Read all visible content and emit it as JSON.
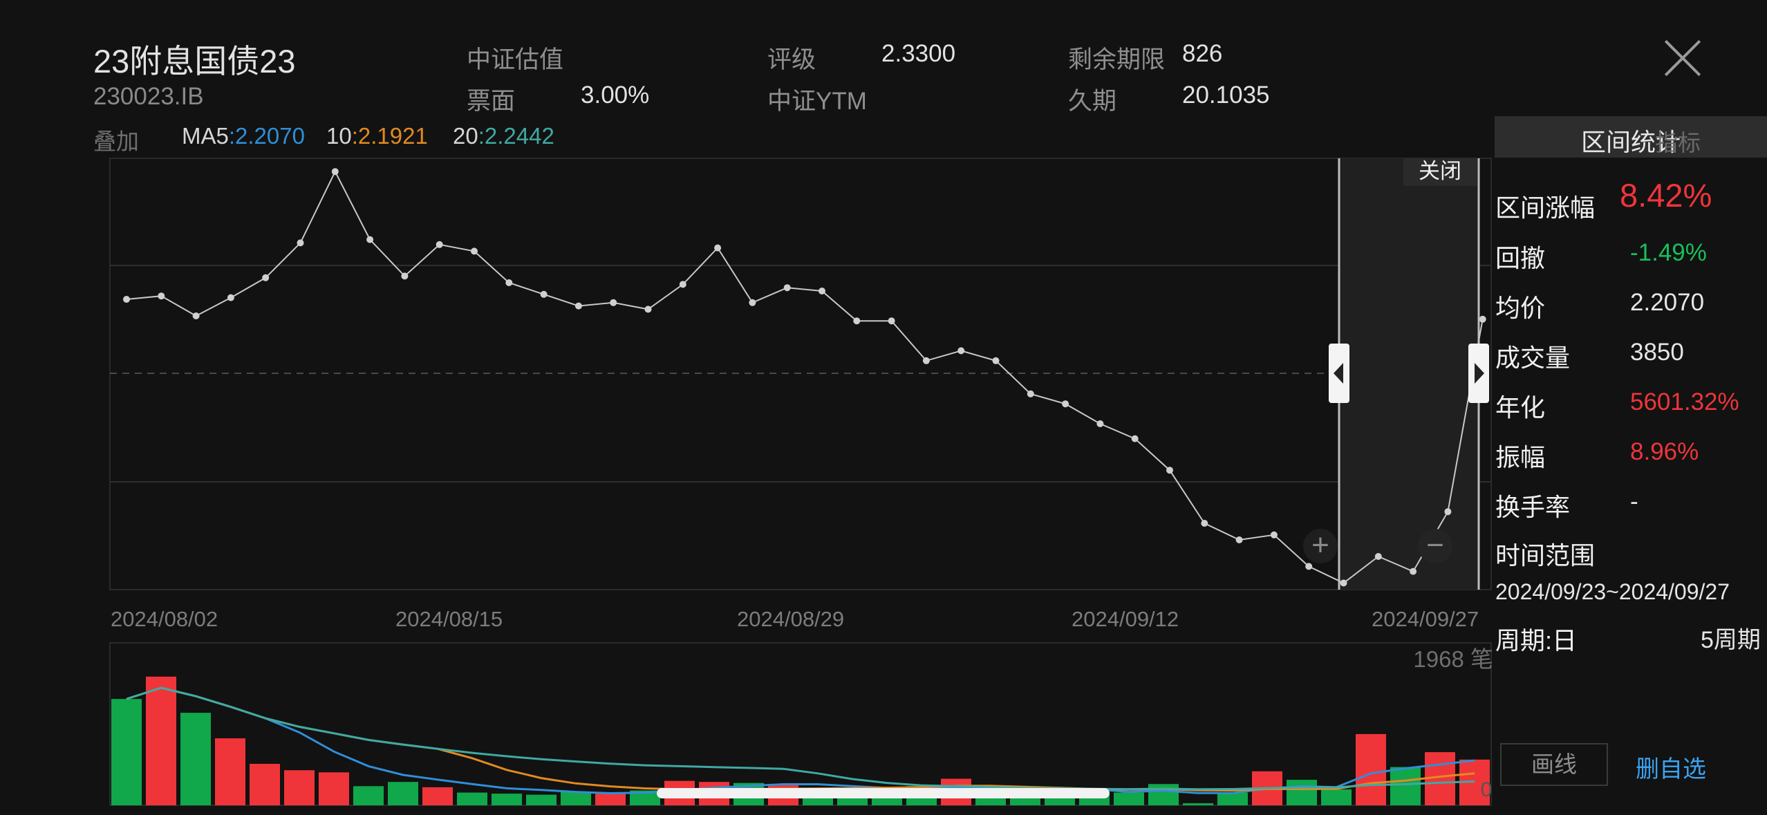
{
  "header": {
    "title": "23附息国债23",
    "code": "230023.IB",
    "valuation_label": "中证估值",
    "rating_label": "评级",
    "rating_value": "2.3300",
    "remaining_label": "剩余期限",
    "remaining_value": "826",
    "coupon_label": "票面",
    "coupon_value": "3.00%",
    "ytm_label": "中证YTM",
    "duration_label": "久期",
    "duration_value": "20.1035"
  },
  "overlay": {
    "label": "叠加",
    "ma5_label": "MA5",
    "ma5_value": ":2.2070",
    "ma10_label": "10",
    "ma10_value": ":2.1921",
    "ma20_label": "20",
    "ma20_value": ":2.2442"
  },
  "chart": {
    "close_label": "关闭",
    "volume_caption": "1968 笔",
    "volume_corner": "0",
    "dates": [
      "2024/08/02",
      "2024/08/15",
      "2024/08/29",
      "2024/09/12",
      "2024/09/27"
    ],
    "zoom_in": "+",
    "zoom_out": "−"
  },
  "colors": {
    "up": "#f0353a",
    "down": "#10a84a",
    "ma5": "#2f8fd8",
    "ma10": "#e28a22",
    "ma20": "#3fa9a4",
    "price_line": "#c8c8c8"
  },
  "panel": {
    "tab_main": "区间统计",
    "tab_behind": "指标",
    "rows": [
      {
        "label": "区间涨幅",
        "value": "8.42%"
      },
      {
        "label": "回撤",
        "value": "-1.49%"
      },
      {
        "label": "均价",
        "value": "2.2070"
      },
      {
        "label": "成交量",
        "value": "3850"
      },
      {
        "label": "年化",
        "value": "5601.32%"
      },
      {
        "label": "振幅",
        "value": "8.96%"
      },
      {
        "label": "换手率",
        "value": "-"
      },
      {
        "label": "时间范围",
        "value": ""
      }
    ],
    "range_value": "2024/09/23~2024/09/27",
    "period_label": "周期:日",
    "period_count": "5周期",
    "draw_button": "画线",
    "delete_link": "删自选"
  },
  "chart_data": {
    "type": "line",
    "x_range": [
      "2024/08/01",
      "2024/09/27"
    ],
    "series": [
      {
        "values": [
          2.115,
          2.117,
          2.105,
          2.116,
          2.128,
          2.149,
          2.192,
          2.151,
          2.129,
          2.148,
          2.144,
          2.125,
          2.118,
          2.111,
          2.113,
          2.109,
          2.124,
          2.146,
          2.113,
          2.122,
          2.12,
          2.102,
          2.102,
          2.078,
          2.084,
          2.078,
          2.058,
          2.052,
          2.04,
          2.031,
          2.012,
          1.98,
          1.97,
          1.973,
          1.954,
          1.944,
          1.96,
          1.951,
          1.987,
          2.103
        ]
      }
    ],
    "volume": {
      "values": [
        100,
        121,
        87,
        63,
        39,
        33,
        31,
        18,
        22,
        17,
        12,
        11,
        10,
        13,
        11,
        14,
        23,
        22,
        21,
        19,
        14,
        14,
        14,
        18,
        25,
        14,
        13,
        12,
        12,
        12,
        20,
        2,
        12,
        32,
        24,
        15,
        67,
        36,
        50,
        43
      ],
      "direction": [
        "down",
        "up",
        "down",
        "up",
        "up",
        "up",
        "up",
        "down",
        "down",
        "up",
        "down",
        "down",
        "down",
        "down",
        "up",
        "down",
        "up",
        "up",
        "down",
        "up",
        "down",
        "down",
        "down",
        "down",
        "up",
        "down",
        "down",
        "down",
        "down",
        "down",
        "down",
        "down",
        "down",
        "up",
        "down",
        "down",
        "up",
        "down",
        "up",
        "up"
      ]
    },
    "selection": [
      "2024/09/23",
      "2024/09/27"
    ],
    "ylim": [
      1.94,
      2.2
    ]
  }
}
